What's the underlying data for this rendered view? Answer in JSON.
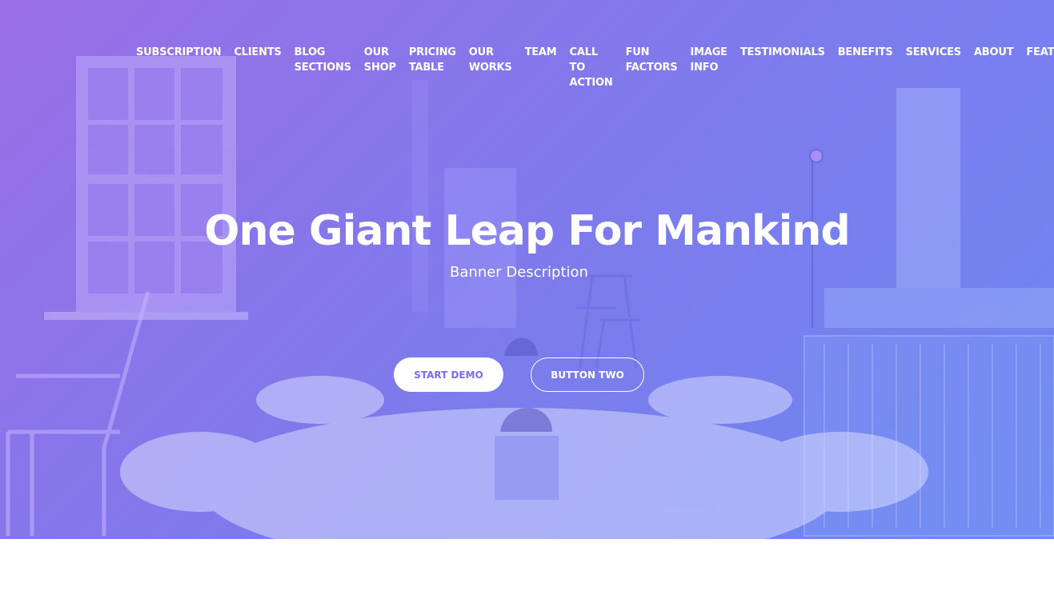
{
  "nav": {
    "items": [
      {
        "lines": [
          "SUBSCRIPTION"
        ]
      },
      {
        "lines": [
          "CLIENTS"
        ]
      },
      {
        "lines": [
          "BLOG",
          "SECTIONS"
        ]
      },
      {
        "lines": [
          "OUR",
          "SHOP"
        ]
      },
      {
        "lines": [
          "PRICING",
          "TABLE"
        ]
      },
      {
        "lines": [
          "OUR",
          "WORKS"
        ]
      },
      {
        "lines": [
          "TEAM"
        ]
      },
      {
        "lines": [
          "CALL",
          "TO",
          "ACTION"
        ]
      },
      {
        "lines": [
          "FUN",
          "FACTORS"
        ]
      },
      {
        "lines": [
          "IMAGE",
          "INFO"
        ]
      },
      {
        "lines": [
          "TESTIMONIALS"
        ]
      },
      {
        "lines": [
          "BENEFITS"
        ]
      },
      {
        "lines": [
          "SERVICES"
        ]
      },
      {
        "lines": [
          "ABOUT"
        ]
      },
      {
        "lines": [
          "FEATURES"
        ]
      }
    ]
  },
  "hero": {
    "title": "One Giant Leap For Mankind",
    "description": "Banner Description",
    "primary_button": "START DEMO",
    "secondary_button": "BUTTON TWO"
  },
  "colors": {
    "gradient_start": "#9a6ee6",
    "gradient_end": "#6c88f0",
    "button_text": "#7b6cec"
  }
}
